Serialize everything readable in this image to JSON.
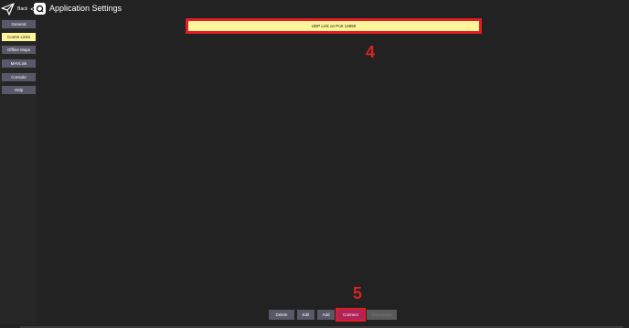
{
  "header": {
    "back_label": "Back",
    "back_chevron": "<",
    "title": "Application Settings",
    "app_icon": "qgc-app-icon"
  },
  "sidebar": {
    "items": [
      {
        "label": "General",
        "active": false
      },
      {
        "label": "Comm Links",
        "active": true
      },
      {
        "label": "Offline Maps",
        "active": false
      },
      {
        "label": "MAVLink",
        "active": false
      },
      {
        "label": "Console",
        "active": false
      },
      {
        "label": "Help",
        "active": false
      }
    ]
  },
  "links": {
    "items": [
      {
        "label": "UDP Link on Port 14550"
      }
    ]
  },
  "annotations": {
    "step4": "4",
    "step5": "5"
  },
  "actions": {
    "delete_label": "Delete",
    "edit_label": "Edit",
    "add_label": "Add",
    "connect_label": "Connect",
    "disconnect_label": "Disconnect"
  },
  "colors": {
    "background": "#222222",
    "button": "#585868",
    "selected": "#fff59a",
    "highlight": "#e21c24",
    "connect": "#b0225a"
  }
}
